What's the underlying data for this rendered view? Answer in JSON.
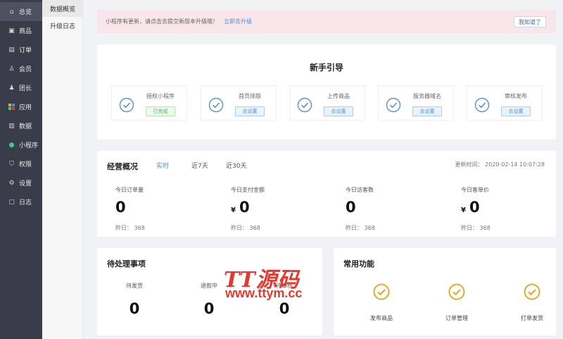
{
  "sidebar": {
    "items": [
      {
        "label": "总览",
        "icon": "home-icon",
        "glyph": "⌂"
      },
      {
        "label": "商品",
        "icon": "goods-icon",
        "glyph": "▣"
      },
      {
        "label": "订单",
        "icon": "order-icon",
        "glyph": "▤"
      },
      {
        "label": "会员",
        "icon": "user-icon",
        "glyph": "♙"
      },
      {
        "label": "团长",
        "icon": "leader-icon",
        "glyph": "♟"
      },
      {
        "label": "应用",
        "icon": "apps-icon",
        "glyph": "▦"
      },
      {
        "label": "数据",
        "icon": "chart-icon",
        "glyph": "▥"
      },
      {
        "label": "小程序",
        "icon": "miniprogram-icon",
        "glyph": "●"
      },
      {
        "label": "权限",
        "icon": "shield-icon",
        "glyph": "⛉"
      },
      {
        "label": "设置",
        "icon": "gear-icon",
        "glyph": "⚙"
      },
      {
        "label": "日志",
        "icon": "log-icon",
        "glyph": "▢"
      }
    ]
  },
  "subnav": {
    "items": [
      {
        "label": "数据概览"
      },
      {
        "label": "升级日志"
      }
    ]
  },
  "notice": {
    "text": "小程序有更新，请点击去提交新版本升级哦！",
    "link": "立即去升级",
    "dismiss": "我知道了"
  },
  "guide": {
    "title": "新手引导",
    "steps": [
      {
        "label": "授权小程序",
        "action": "已完成",
        "done": true
      },
      {
        "label": "首页排版",
        "action": "去设置",
        "done": false
      },
      {
        "label": "上传商品",
        "action": "去设置",
        "done": false
      },
      {
        "label": "服务器域名",
        "action": "去设置",
        "done": false
      },
      {
        "label": "审核发布",
        "action": "去设置",
        "done": false
      }
    ]
  },
  "overview": {
    "title": "经营概况",
    "tabs": [
      "实时",
      "近7天",
      "近30天"
    ],
    "updated": "更新时间： 2020-02-14 10:07:28",
    "stats": [
      {
        "label": "今日订单量",
        "value": "0",
        "currency": "",
        "yesterday": "昨日： 368"
      },
      {
        "label": "今日支付金额",
        "value": "0",
        "currency": "¥",
        "yesterday": "昨日： 368"
      },
      {
        "label": "今日访客数",
        "value": "0",
        "currency": "",
        "yesterday": "昨日： 368"
      },
      {
        "label": "今日客单价",
        "value": "0",
        "currency": "¥",
        "yesterday": "昨日： 368"
      }
    ]
  },
  "pending": {
    "title": "待处理事项",
    "items": [
      {
        "label": "待发货",
        "value": "0"
      },
      {
        "label": "退款中",
        "value": "0"
      },
      {
        "label": "待审核",
        "value": "0"
      }
    ]
  },
  "functions": {
    "title": "常用功能",
    "items": [
      {
        "label": "发布商品"
      },
      {
        "label": "订单管理"
      },
      {
        "label": "打单发货"
      }
    ]
  },
  "watermark": {
    "line1": "TT源码",
    "line2": "www.ttym.cc"
  },
  "colors": {
    "accent": "#4a90d9",
    "sidebar_bg": "#393d49",
    "check_blue": "#5b8fd6",
    "check_gold": "#e8a92a",
    "watermark_red": "#e5392f"
  }
}
